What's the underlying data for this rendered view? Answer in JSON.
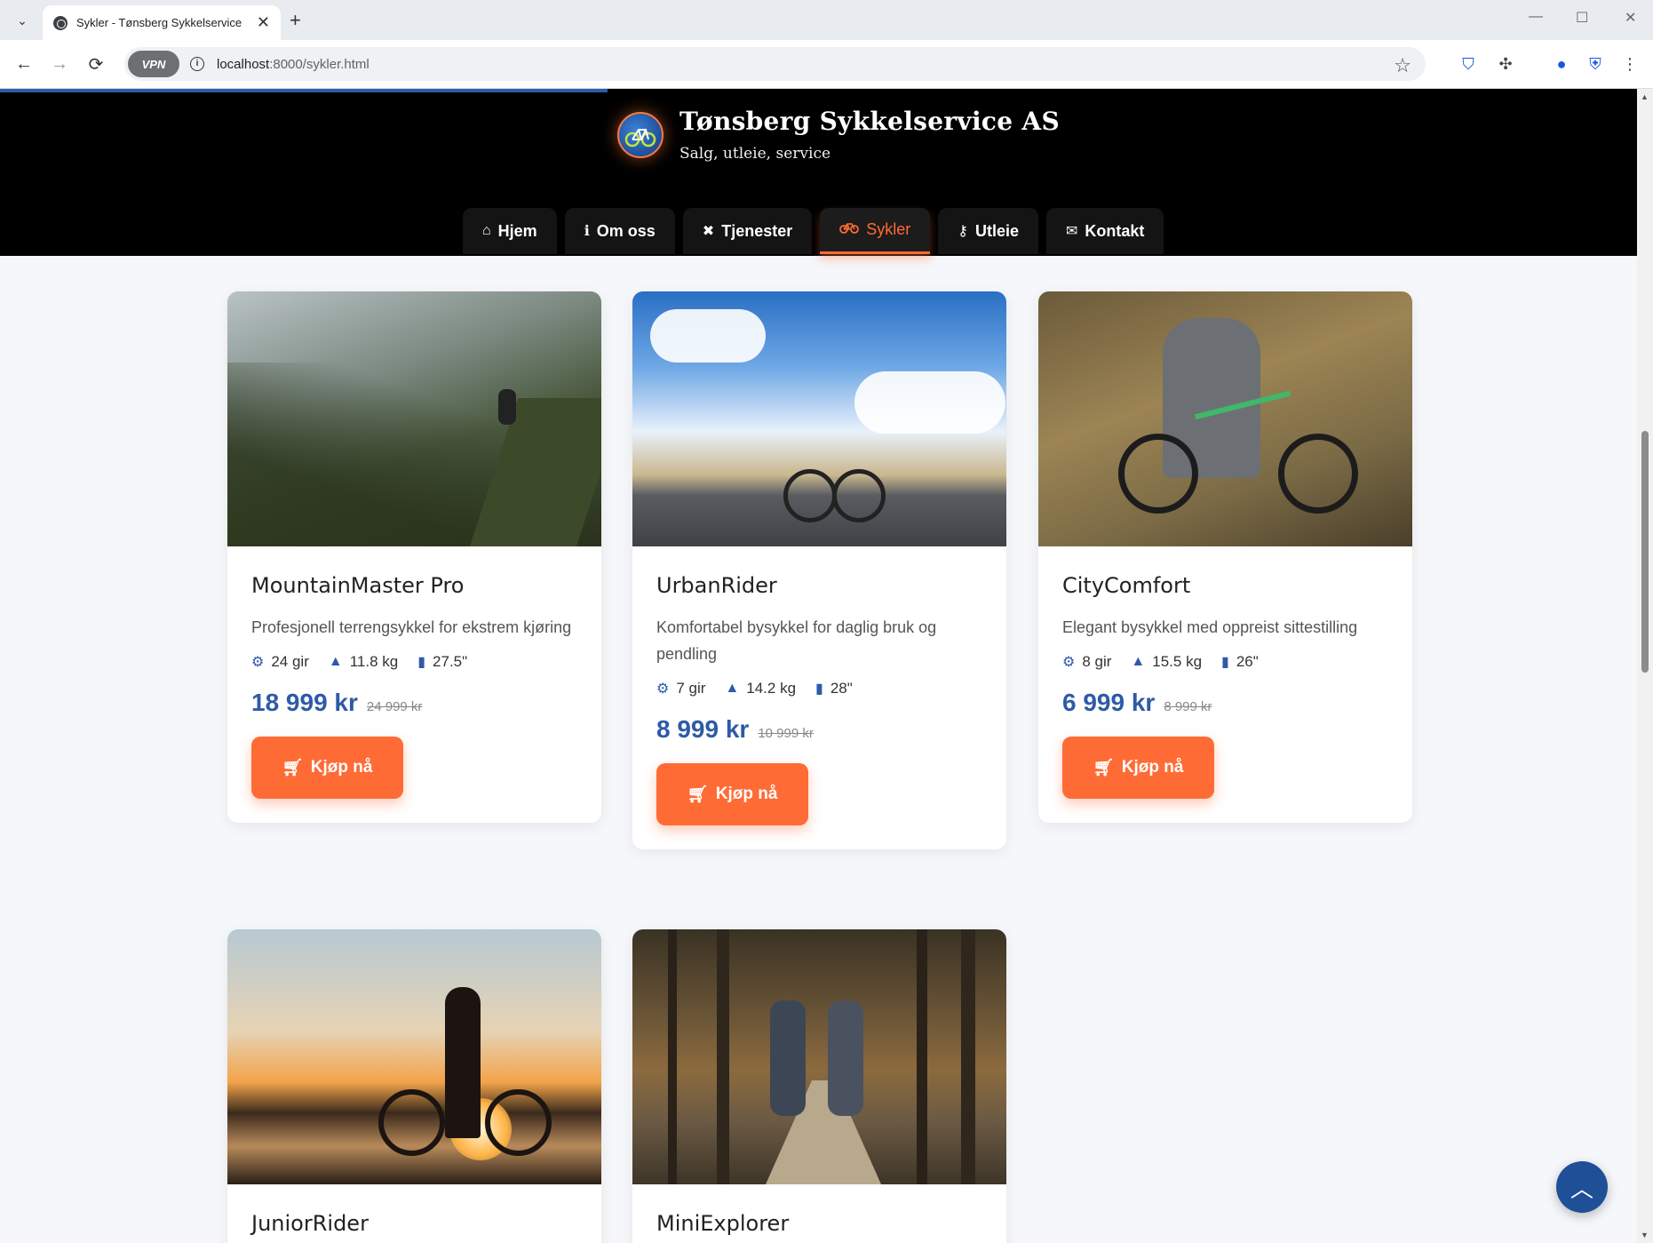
{
  "browser": {
    "tab_title": "Sykler - Tønsberg Sykkelservice og",
    "url_host": "localhost",
    "url_rest": ":8000/sykler.html",
    "vpn_label": "VPN"
  },
  "header": {
    "site_name": "Tønsberg Sykkelservice AS",
    "tagline": "Salg, utleie, service"
  },
  "nav": [
    {
      "label": "Hjem",
      "icon": "home-icon",
      "glyph": "⌂"
    },
    {
      "label": "Om oss",
      "icon": "info-icon",
      "glyph": "ℹ"
    },
    {
      "label": "Tjenester",
      "icon": "tools-icon",
      "glyph": "✖"
    },
    {
      "label": "Sykler",
      "icon": "bicycle-icon",
      "glyph": "⚲"
    },
    {
      "label": "Utleie",
      "icon": "key-icon",
      "glyph": "⚷"
    },
    {
      "label": "Kontakt",
      "icon": "envelope-icon",
      "glyph": "✉"
    }
  ],
  "active_nav": "Sykler",
  "bikes": [
    {
      "name": "MountainMaster Pro",
      "description": "Profesjonell terrengsykkel for ekstrem kjøring",
      "gears": "24 gir",
      "weight": "11.8 kg",
      "wheel": "27.5\"",
      "price": "18 999 kr",
      "old_price": "24 999 kr",
      "buy_label": "Kjøp nå"
    },
    {
      "name": "UrbanRider",
      "description": "Komfortabel bysykkel for daglig bruk og pendling",
      "gears": "7 gir",
      "weight": "14.2 kg",
      "wheel": "28\"",
      "price": "8 999 kr",
      "old_price": "10 999 kr",
      "buy_label": "Kjøp nå"
    },
    {
      "name": "CityComfort",
      "description": "Elegant bysykkel med oppreist sittestilling",
      "gears": "8 gir",
      "weight": "15.5 kg",
      "wheel": "26\"",
      "price": "6 999 kr",
      "old_price": "8 999 kr",
      "buy_label": "Kjøp nå"
    },
    {
      "name": "JuniorRider"
    },
    {
      "name": "MiniExplorer"
    }
  ],
  "colors": {
    "accent": "#ff6b35",
    "brand_blue": "#2e5aa7",
    "header_bg": "#000000"
  }
}
